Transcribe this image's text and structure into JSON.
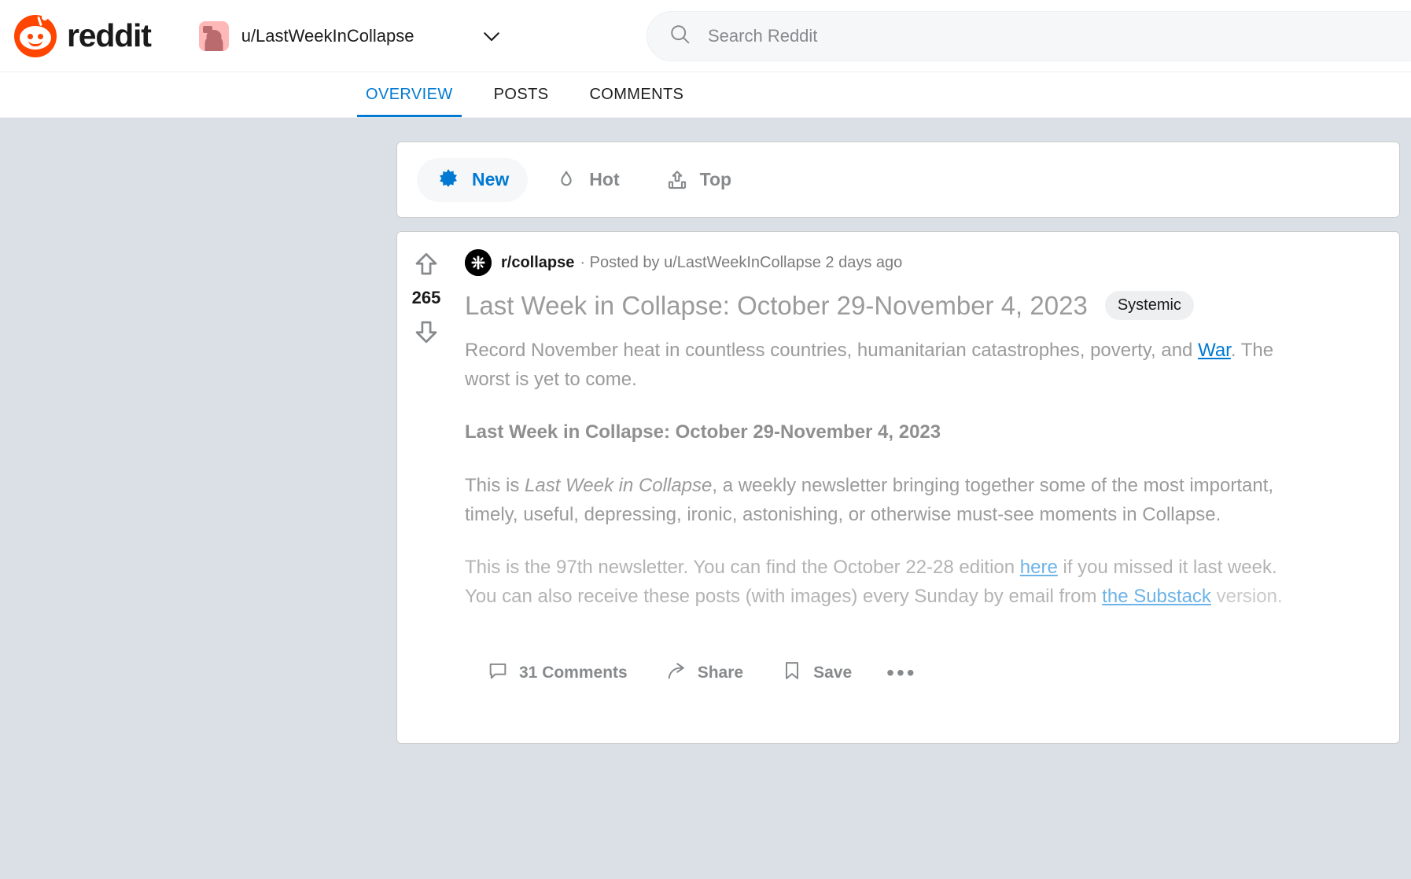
{
  "brand": {
    "name": "reddit"
  },
  "account": {
    "username": "u/LastWeekInCollapse"
  },
  "search": {
    "placeholder": "Search Reddit"
  },
  "tabs": [
    {
      "label": "OVERVIEW",
      "active": true
    },
    {
      "label": "POSTS",
      "active": false
    },
    {
      "label": "COMMENTS",
      "active": false
    }
  ],
  "sort": [
    {
      "label": "New",
      "icon": "sparkle-burst-icon",
      "active": true
    },
    {
      "label": "Hot",
      "icon": "flame-icon",
      "active": false
    },
    {
      "label": "Top",
      "icon": "bar-chart-up-icon",
      "active": false
    }
  ],
  "post": {
    "votes": "265",
    "subreddit": "r/collapse",
    "meta": "· Posted by u/LastWeekInCollapse 2 days ago",
    "title": "Last Week in Collapse: October 29-November 4, 2023",
    "flair": "Systemic",
    "summary_before_link": "Record November heat in countless countries, humanitarian catastrophes, poverty, and ",
    "summary_link": "War",
    "summary_after_link": ". The worst is yet to come.",
    "heading": "Last Week in Collapse: October 29-November 4, 2023",
    "para_intro_a": "This is ",
    "para_intro_italic": "Last Week in Collapse",
    "para_intro_b": ", a weekly newsletter bringing together some of the most important, timely, useful, depressing, ironic, astonishing, or otherwise must-see moments in Collapse.",
    "para_nl_a": "This is the 97th newsletter. You can find the October 22-28 edition ",
    "para_nl_link1": "here",
    "para_nl_b": " if you missed it last week. You can also receive these posts (with images) every Sunday by email from ",
    "para_nl_link2": "the Substack",
    "para_nl_c": " version.",
    "actions": {
      "comments": "31 Comments",
      "share": "Share",
      "save": "Save",
      "more": "•••"
    }
  },
  "colors": {
    "accent": "#0079d3",
    "brand_orange": "#ff4500",
    "page_bg": "#dae0e6"
  }
}
